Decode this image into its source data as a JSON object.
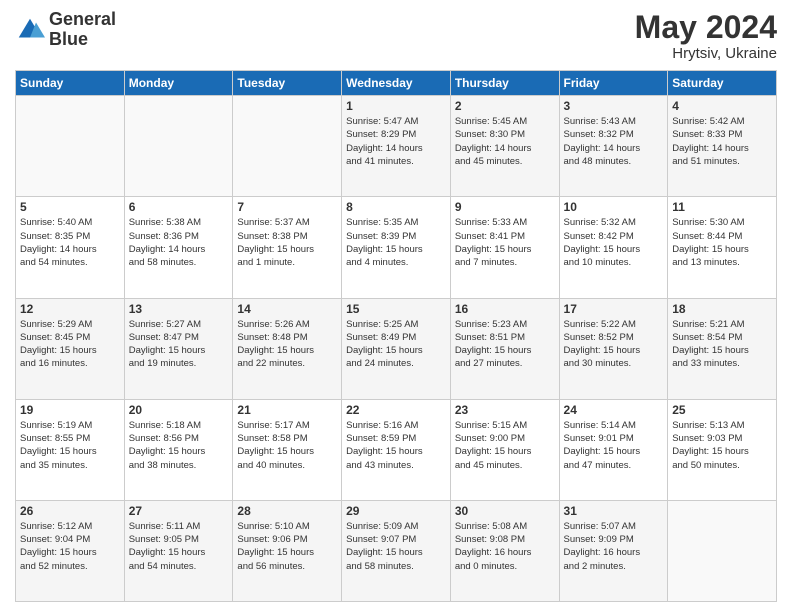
{
  "header": {
    "logo_line1": "General",
    "logo_line2": "Blue",
    "title": "May 2024",
    "location": "Hrytsiv, Ukraine"
  },
  "days_of_week": [
    "Sunday",
    "Monday",
    "Tuesday",
    "Wednesday",
    "Thursday",
    "Friday",
    "Saturday"
  ],
  "weeks": [
    [
      {
        "day": "",
        "info": ""
      },
      {
        "day": "",
        "info": ""
      },
      {
        "day": "",
        "info": ""
      },
      {
        "day": "1",
        "info": "Sunrise: 5:47 AM\nSunset: 8:29 PM\nDaylight: 14 hours\nand 41 minutes."
      },
      {
        "day": "2",
        "info": "Sunrise: 5:45 AM\nSunset: 8:30 PM\nDaylight: 14 hours\nand 45 minutes."
      },
      {
        "day": "3",
        "info": "Sunrise: 5:43 AM\nSunset: 8:32 PM\nDaylight: 14 hours\nand 48 minutes."
      },
      {
        "day": "4",
        "info": "Sunrise: 5:42 AM\nSunset: 8:33 PM\nDaylight: 14 hours\nand 51 minutes."
      }
    ],
    [
      {
        "day": "5",
        "info": "Sunrise: 5:40 AM\nSunset: 8:35 PM\nDaylight: 14 hours\nand 54 minutes."
      },
      {
        "day": "6",
        "info": "Sunrise: 5:38 AM\nSunset: 8:36 PM\nDaylight: 14 hours\nand 58 minutes."
      },
      {
        "day": "7",
        "info": "Sunrise: 5:37 AM\nSunset: 8:38 PM\nDaylight: 15 hours\nand 1 minute."
      },
      {
        "day": "8",
        "info": "Sunrise: 5:35 AM\nSunset: 8:39 PM\nDaylight: 15 hours\nand 4 minutes."
      },
      {
        "day": "9",
        "info": "Sunrise: 5:33 AM\nSunset: 8:41 PM\nDaylight: 15 hours\nand 7 minutes."
      },
      {
        "day": "10",
        "info": "Sunrise: 5:32 AM\nSunset: 8:42 PM\nDaylight: 15 hours\nand 10 minutes."
      },
      {
        "day": "11",
        "info": "Sunrise: 5:30 AM\nSunset: 8:44 PM\nDaylight: 15 hours\nand 13 minutes."
      }
    ],
    [
      {
        "day": "12",
        "info": "Sunrise: 5:29 AM\nSunset: 8:45 PM\nDaylight: 15 hours\nand 16 minutes."
      },
      {
        "day": "13",
        "info": "Sunrise: 5:27 AM\nSunset: 8:47 PM\nDaylight: 15 hours\nand 19 minutes."
      },
      {
        "day": "14",
        "info": "Sunrise: 5:26 AM\nSunset: 8:48 PM\nDaylight: 15 hours\nand 22 minutes."
      },
      {
        "day": "15",
        "info": "Sunrise: 5:25 AM\nSunset: 8:49 PM\nDaylight: 15 hours\nand 24 minutes."
      },
      {
        "day": "16",
        "info": "Sunrise: 5:23 AM\nSunset: 8:51 PM\nDaylight: 15 hours\nand 27 minutes."
      },
      {
        "day": "17",
        "info": "Sunrise: 5:22 AM\nSunset: 8:52 PM\nDaylight: 15 hours\nand 30 minutes."
      },
      {
        "day": "18",
        "info": "Sunrise: 5:21 AM\nSunset: 8:54 PM\nDaylight: 15 hours\nand 33 minutes."
      }
    ],
    [
      {
        "day": "19",
        "info": "Sunrise: 5:19 AM\nSunset: 8:55 PM\nDaylight: 15 hours\nand 35 minutes."
      },
      {
        "day": "20",
        "info": "Sunrise: 5:18 AM\nSunset: 8:56 PM\nDaylight: 15 hours\nand 38 minutes."
      },
      {
        "day": "21",
        "info": "Sunrise: 5:17 AM\nSunset: 8:58 PM\nDaylight: 15 hours\nand 40 minutes."
      },
      {
        "day": "22",
        "info": "Sunrise: 5:16 AM\nSunset: 8:59 PM\nDaylight: 15 hours\nand 43 minutes."
      },
      {
        "day": "23",
        "info": "Sunrise: 5:15 AM\nSunset: 9:00 PM\nDaylight: 15 hours\nand 45 minutes."
      },
      {
        "day": "24",
        "info": "Sunrise: 5:14 AM\nSunset: 9:01 PM\nDaylight: 15 hours\nand 47 minutes."
      },
      {
        "day": "25",
        "info": "Sunrise: 5:13 AM\nSunset: 9:03 PM\nDaylight: 15 hours\nand 50 minutes."
      }
    ],
    [
      {
        "day": "26",
        "info": "Sunrise: 5:12 AM\nSunset: 9:04 PM\nDaylight: 15 hours\nand 52 minutes."
      },
      {
        "day": "27",
        "info": "Sunrise: 5:11 AM\nSunset: 9:05 PM\nDaylight: 15 hours\nand 54 minutes."
      },
      {
        "day": "28",
        "info": "Sunrise: 5:10 AM\nSunset: 9:06 PM\nDaylight: 15 hours\nand 56 minutes."
      },
      {
        "day": "29",
        "info": "Sunrise: 5:09 AM\nSunset: 9:07 PM\nDaylight: 15 hours\nand 58 minutes."
      },
      {
        "day": "30",
        "info": "Sunrise: 5:08 AM\nSunset: 9:08 PM\nDaylight: 16 hours\nand 0 minutes."
      },
      {
        "day": "31",
        "info": "Sunrise: 5:07 AM\nSunset: 9:09 PM\nDaylight: 16 hours\nand 2 minutes."
      },
      {
        "day": "",
        "info": ""
      }
    ]
  ]
}
